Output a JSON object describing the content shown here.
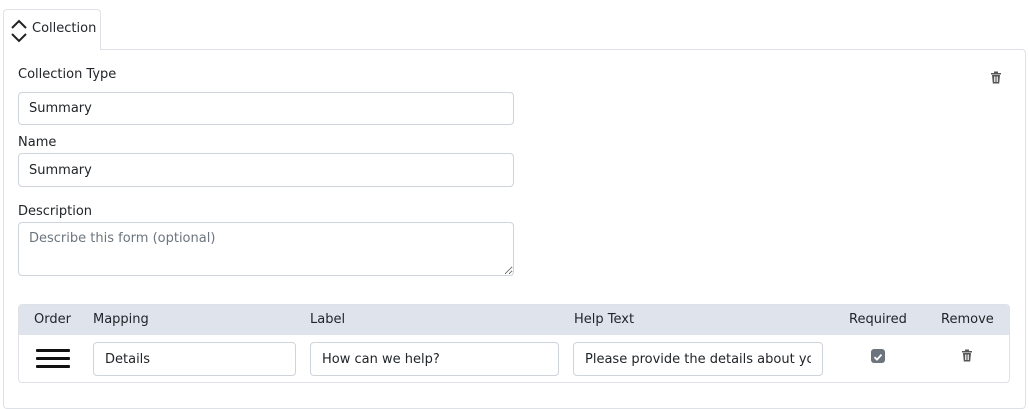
{
  "tab": {
    "label": "Collection"
  },
  "form": {
    "collection_type_label": "Collection Type",
    "collection_type_value": "Summary",
    "name_label": "Name",
    "name_value": "Summary",
    "description_label": "Description",
    "description_placeholder": "Describe this form (optional)"
  },
  "table": {
    "headers": [
      "Order",
      "Mapping",
      "Label",
      "Help Text",
      "Required",
      "Remove"
    ],
    "rows": [
      {
        "mapping": "Details",
        "label": "How can we help?",
        "help_text": "Please provide the details about your request",
        "required": true
      }
    ]
  },
  "icons": [
    "chevron-up-down-icon",
    "trash-icon",
    "drag-handle-icon",
    "checkbox-checked-icon"
  ],
  "colors": {
    "table_header_bg": "#dfe4ec",
    "border": "#dee2e6",
    "checkbox": "#6c757d"
  }
}
